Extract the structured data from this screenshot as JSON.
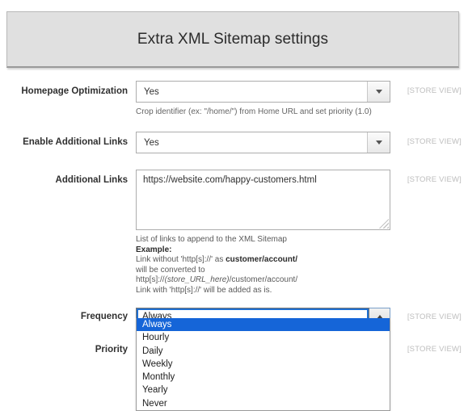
{
  "header": {
    "title": "Extra XML Sitemap settings"
  },
  "scope_label": "[STORE VIEW]",
  "fields": {
    "homepage_optimization": {
      "label": "Homepage Optimization",
      "value": "Yes",
      "hint": "Crop identifier (ex: \"/home/\") from Home URL and set priority (1.0)",
      "scope": "[STORE VIEW]"
    },
    "enable_additional_links": {
      "label": "Enable Additional Links",
      "value": "Yes",
      "scope": "[STORE VIEW]"
    },
    "additional_links": {
      "label": "Additional Links",
      "value": "https://website.com/happy-customers.html",
      "scope": "[STORE VIEW]",
      "help": {
        "line1": "List of links to append to the XML Sitemap",
        "example_label": "Example:",
        "line2_a": "Link without 'http[s]://' as ",
        "line2_b": "customer/account/",
        "line3": "will be converted to",
        "line4_a": "http[s]://",
        "line4_b": "(store_URL_here)",
        "line4_c": "/customer/account/",
        "line5": "Link with 'http[s]://' will be added as is."
      }
    },
    "frequency": {
      "label": "Frequency",
      "value": "Always",
      "scope": "[STORE VIEW]",
      "options": [
        "Always",
        "Hourly",
        "Daily",
        "Weekly",
        "Monthly",
        "Yearly",
        "Never"
      ],
      "selected_index": 0
    },
    "priority": {
      "label": "Priority",
      "scope": "[STORE VIEW]"
    }
  },
  "icons": {
    "dropdown_closed": "chevron-down-icon",
    "dropdown_open": "chevron-up-icon",
    "resize": "resize-grip-icon"
  }
}
